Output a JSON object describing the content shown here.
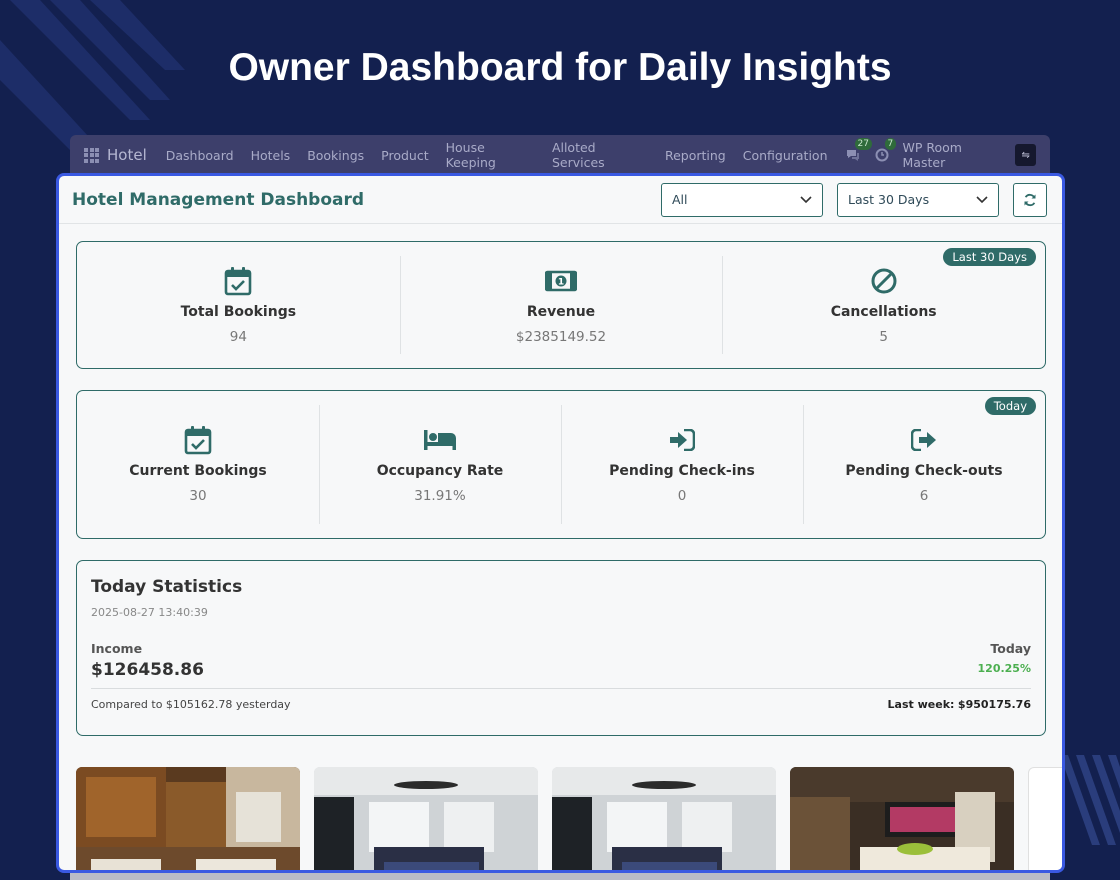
{
  "hero": {
    "title": "Owner Dashboard for Daily Insights"
  },
  "navbar": {
    "brand": "Hotel",
    "items": [
      "Dashboard",
      "Hotels",
      "Bookings",
      "Product",
      "House Keeping",
      "Alloted Services",
      "Reporting",
      "Configuration"
    ],
    "messages_count": "27",
    "notifications_count": "7",
    "user": "WP Room Master"
  },
  "header": {
    "title": "Hotel Management Dashboard",
    "filter_value": "All",
    "range_value": "Last 30 Days"
  },
  "summary": {
    "badge": "Last 30 Days",
    "items": [
      {
        "icon": "calendar-check-icon",
        "label": "Total Bookings",
        "value": "94"
      },
      {
        "icon": "money-bill-icon",
        "label": "Revenue",
        "value": "$2385149.52"
      },
      {
        "icon": "ban-icon",
        "label": "Cancellations",
        "value": "5"
      }
    ]
  },
  "today": {
    "badge": "Today",
    "items": [
      {
        "icon": "calendar-check-icon",
        "label": "Current Bookings",
        "value": "30"
      },
      {
        "icon": "bed-icon",
        "label": "Occupancy Rate",
        "value": "31.91%"
      },
      {
        "icon": "sign-in-icon",
        "label": "Pending Check-ins",
        "value": "0"
      },
      {
        "icon": "sign-out-icon",
        "label": "Pending Check-outs",
        "value": "6"
      }
    ]
  },
  "today_stats": {
    "title": "Today Statistics",
    "datetime": "2025-08-27 13:40:39",
    "income_label": "Income",
    "income_value": "$126458.86",
    "period_label": "Today",
    "change_pct": "120.25%",
    "compared_text": "Compared to $105162.78 yesterday",
    "last_week_label": "Last week:",
    "last_week_value": "$950175.76"
  },
  "colors": {
    "accent": "#2f6b68",
    "panel_border": "#3a59e2",
    "background": "#13204f",
    "positive": "#4caf50"
  }
}
